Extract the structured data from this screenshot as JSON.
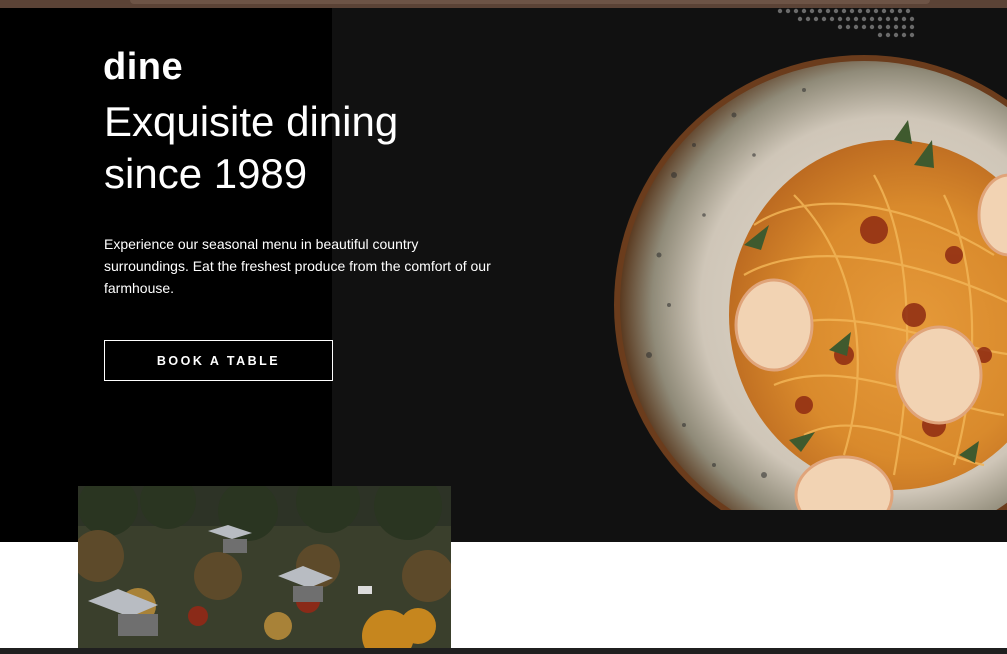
{
  "brand": {
    "logo": "dine"
  },
  "hero": {
    "headline": "Exquisite dining\nsince 1989",
    "tagline": "Experience our seasonal menu in beautiful country surroundings. Eat the freshest produce from the comfort of our farmhouse.",
    "cta_label": "BOOK A TABLE"
  },
  "images": {
    "hero_dish": "pasta-shrimp-plate",
    "farmhouse": "autumn-village-aerial"
  },
  "colors": {
    "hero_left_bg": "#000000",
    "hero_right_bg": "#111111",
    "text": "#ffffff",
    "page_bg": "#ffffff",
    "browser_chrome": "#5b4336"
  }
}
